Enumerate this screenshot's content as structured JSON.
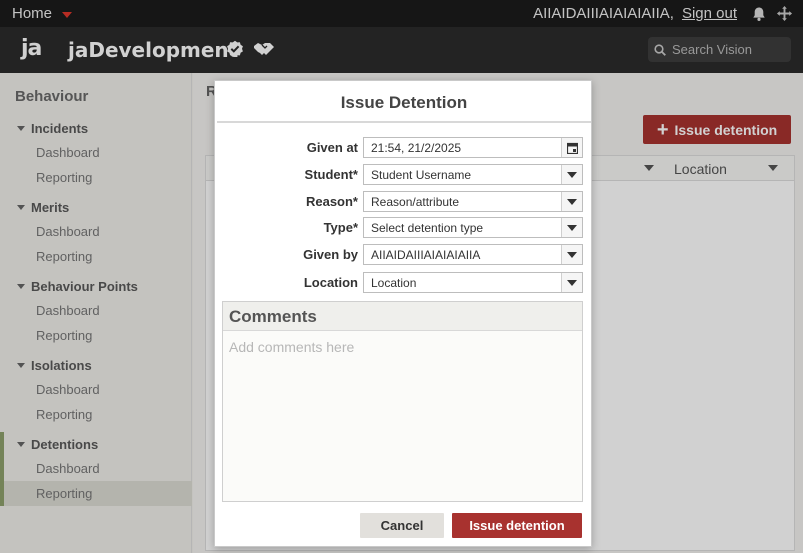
{
  "topbar": {
    "home_label": "Home",
    "user_name": "AIIAIDAIIIAIAIAIAIIA,",
    "signout_label": "Sign out"
  },
  "header": {
    "logo_text": "ja",
    "app_name": "jaDevelopment",
    "search_placeholder": "Search Vision"
  },
  "sidebar": {
    "title": "Behaviour",
    "groups": [
      {
        "label": "Incidents",
        "items": [
          "Dashboard",
          "Reporting"
        ]
      },
      {
        "label": "Merits",
        "items": [
          "Dashboard",
          "Reporting"
        ]
      },
      {
        "label": "Behaviour Points",
        "items": [
          "Dashboard",
          "Reporting"
        ]
      },
      {
        "label": "Isolations",
        "items": [
          "Dashboard",
          "Reporting"
        ]
      },
      {
        "label": "Detentions",
        "items": [
          "Dashboard",
          "Reporting"
        ]
      }
    ]
  },
  "main": {
    "heading_letter": "R",
    "issue_button": "Issue detention",
    "location_column": "Location"
  },
  "modal": {
    "title": "Issue Detention",
    "fields": {
      "given_at": {
        "label": "Given at",
        "value": "21:54, 21/2/2025"
      },
      "student": {
        "label": "Student*",
        "value": "Student Username"
      },
      "reason": {
        "label": "Reason*",
        "value": "Reason/attribute"
      },
      "type": {
        "label": "Type*",
        "value": "Select detention type"
      },
      "given_by": {
        "label": "Given by",
        "value": "AIIAIDAIIIAIAIAIAIIA"
      },
      "location": {
        "label": "Location",
        "value": "Location"
      }
    },
    "comments_title": "Comments",
    "comments_placeholder": "Add comments here",
    "cancel_label": "Cancel",
    "submit_label": "Issue detention"
  },
  "colors": {
    "accent_red": "#a8322f",
    "topbar_bg": "#1b1b1b",
    "header_bg": "#2b2b2b",
    "active_marker": "#8ea06c"
  }
}
